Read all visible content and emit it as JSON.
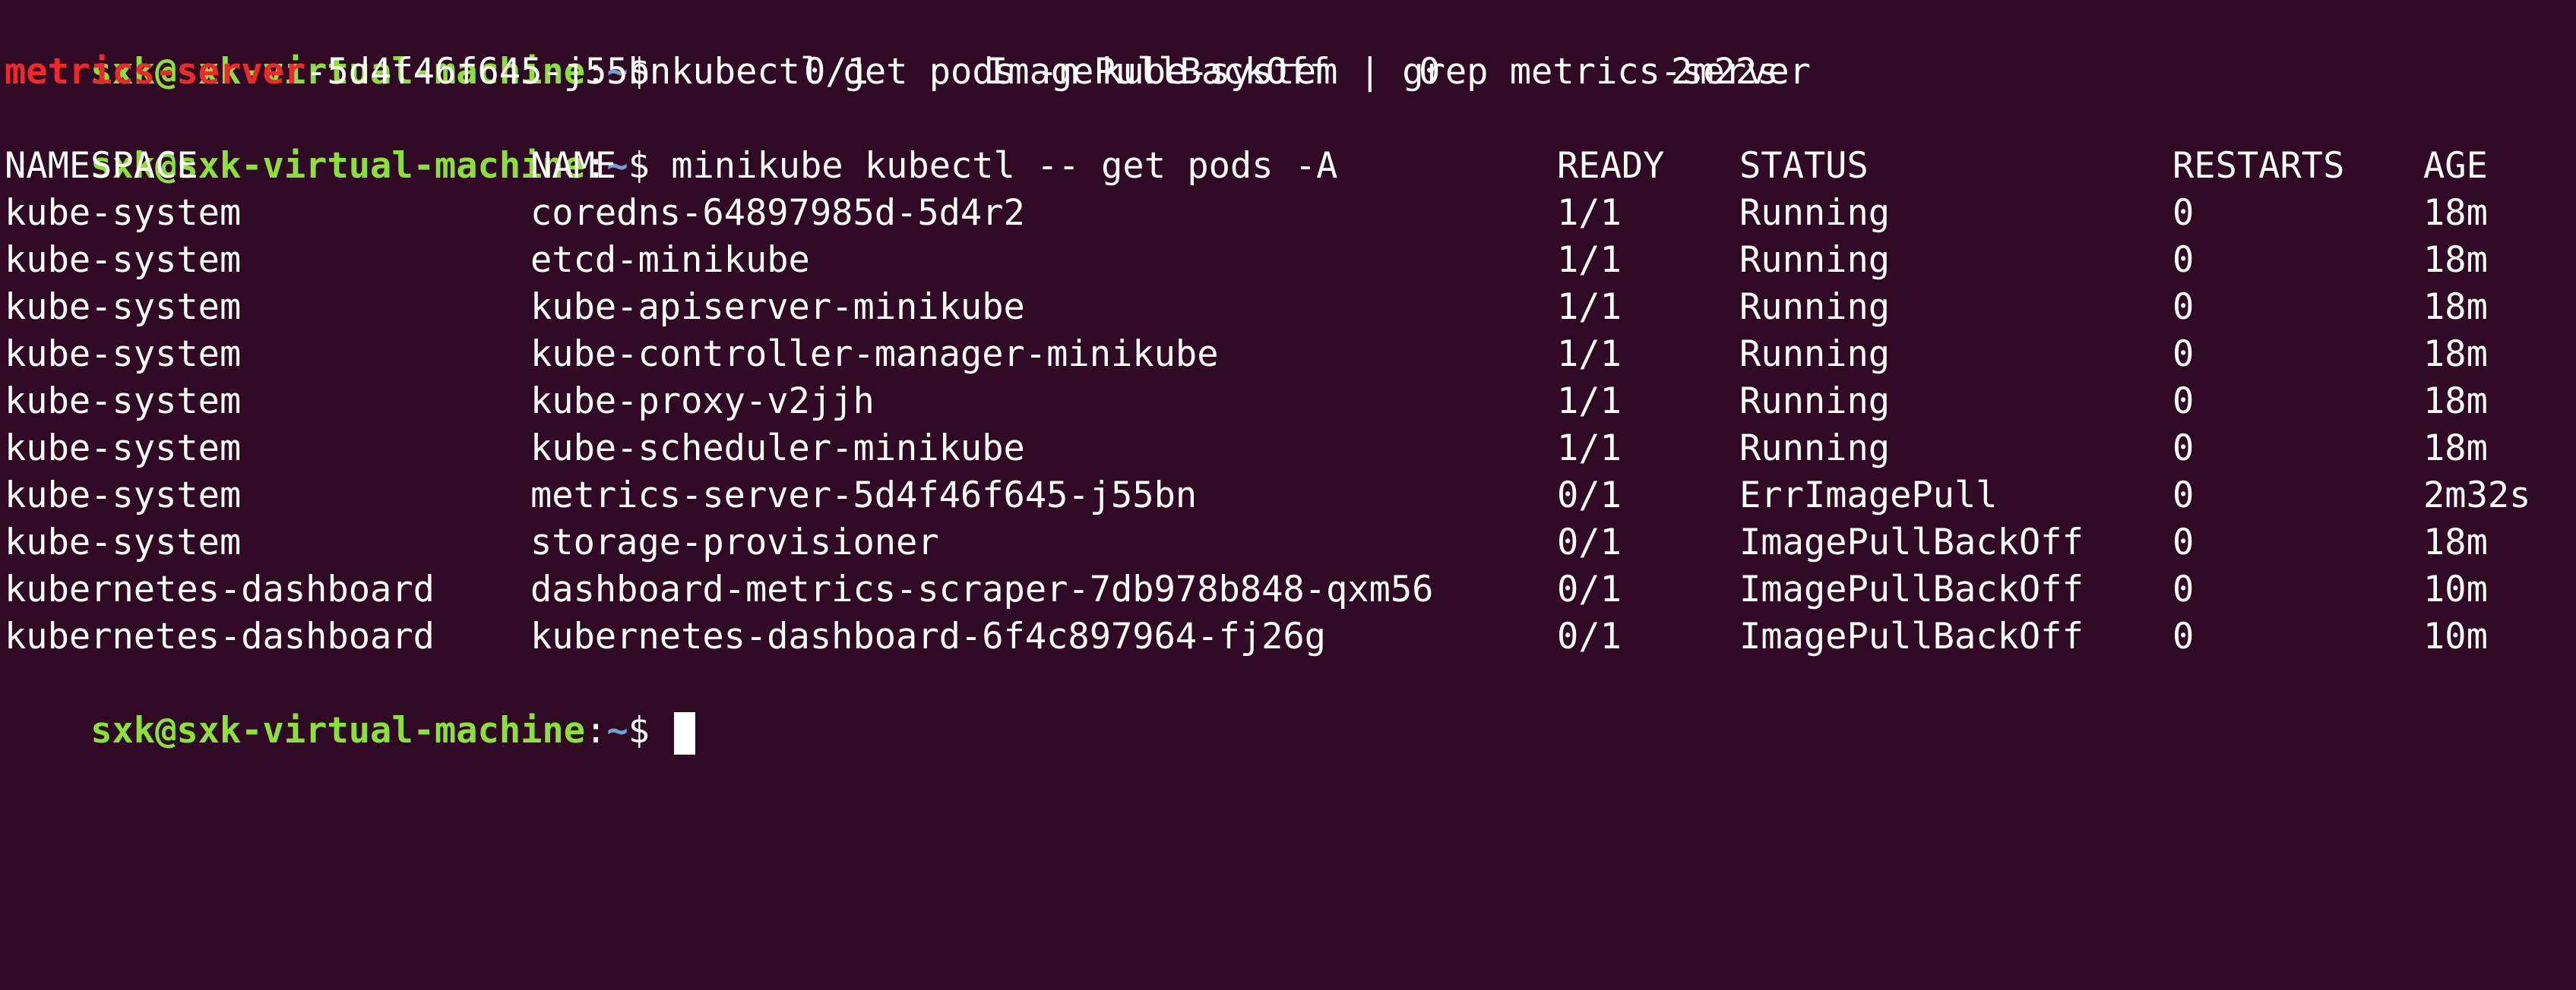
{
  "colors": {
    "background": "#300a24",
    "prompt_user": "#8ae234",
    "prompt_path": "#729fcf",
    "grep_match": "#ef2929",
    "text": "#ffffff"
  },
  "prompt": {
    "user_host": "sxk@sxk-virtual-machine",
    "colon": ":",
    "path": "~",
    "dollar": "$"
  },
  "commands": [
    " kubectl get pods -n kube-system | grep metrics-server",
    " minikube kubectl -- get pods -A"
  ],
  "grep_result": {
    "match": "metrics-server",
    "rest_name": "-5d4f46f645-j55bn",
    "ready": "0/1",
    "status": "ImagePullBackOff",
    "restarts": "0",
    "age": "2m22s"
  },
  "table": {
    "headers": [
      "NAMESPACE",
      "NAME",
      "READY",
      "STATUS",
      "RESTARTS",
      "AGE"
    ],
    "rows": [
      [
        "kube-system",
        "coredns-64897985d-5d4r2",
        "1/1",
        "Running",
        "0",
        "18m"
      ],
      [
        "kube-system",
        "etcd-minikube",
        "1/1",
        "Running",
        "0",
        "18m"
      ],
      [
        "kube-system",
        "kube-apiserver-minikube",
        "1/1",
        "Running",
        "0",
        "18m"
      ],
      [
        "kube-system",
        "kube-controller-manager-minikube",
        "1/1",
        "Running",
        "0",
        "18m"
      ],
      [
        "kube-system",
        "kube-proxy-v2jjh",
        "1/1",
        "Running",
        "0",
        "18m"
      ],
      [
        "kube-system",
        "kube-scheduler-minikube",
        "1/1",
        "Running",
        "0",
        "18m"
      ],
      [
        "kube-system",
        "metrics-server-5d4f46f645-j55bn",
        "0/1",
        "ErrImagePull",
        "0",
        "2m32s"
      ],
      [
        "kube-system",
        "storage-provisioner",
        "0/1",
        "ImagePullBackOff",
        "0",
        "18m"
      ],
      [
        "kubernetes-dashboard",
        "dashboard-metrics-scraper-7db978b848-qxm56",
        "0/1",
        "ImagePullBackOff",
        "0",
        "10m"
      ],
      [
        "kubernetes-dashboard",
        "kubernetes-dashboard-6f4c897964-fj26g",
        "0/1",
        "ImagePullBackOff",
        "0",
        "10m"
      ]
    ]
  }
}
